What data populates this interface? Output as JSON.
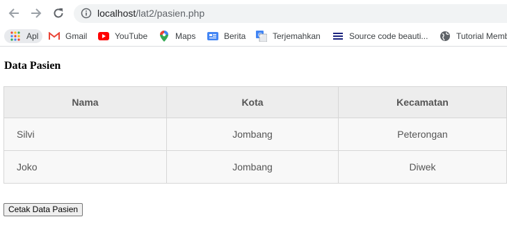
{
  "browser": {
    "url_host": "localhost",
    "url_path": "/lat2/pasien.php"
  },
  "bookmarks": [
    {
      "label": "Apl",
      "icon": "apps-grid-icon"
    },
    {
      "label": "Gmail",
      "icon": "gmail-icon"
    },
    {
      "label": "YouTube",
      "icon": "youtube-icon"
    },
    {
      "label": "Maps",
      "icon": "maps-pin-icon"
    },
    {
      "label": "Berita",
      "icon": "news-icon"
    },
    {
      "label": "Terjemahkan",
      "icon": "translate-icon"
    },
    {
      "label": "Source code beauti...",
      "icon": "list-icon"
    },
    {
      "label": "Tutorial Memb",
      "icon": "globe-icon"
    }
  ],
  "page": {
    "title": "Data Pasien",
    "table": {
      "headers": [
        "Nama",
        "Kota",
        "Kecamatan"
      ],
      "rows": [
        [
          "Silvi",
          "Jombang",
          "Peterongan"
        ],
        [
          "Joko",
          "Jombang",
          "Diwek"
        ]
      ]
    },
    "print_button": "Cetak Data Pasien"
  }
}
